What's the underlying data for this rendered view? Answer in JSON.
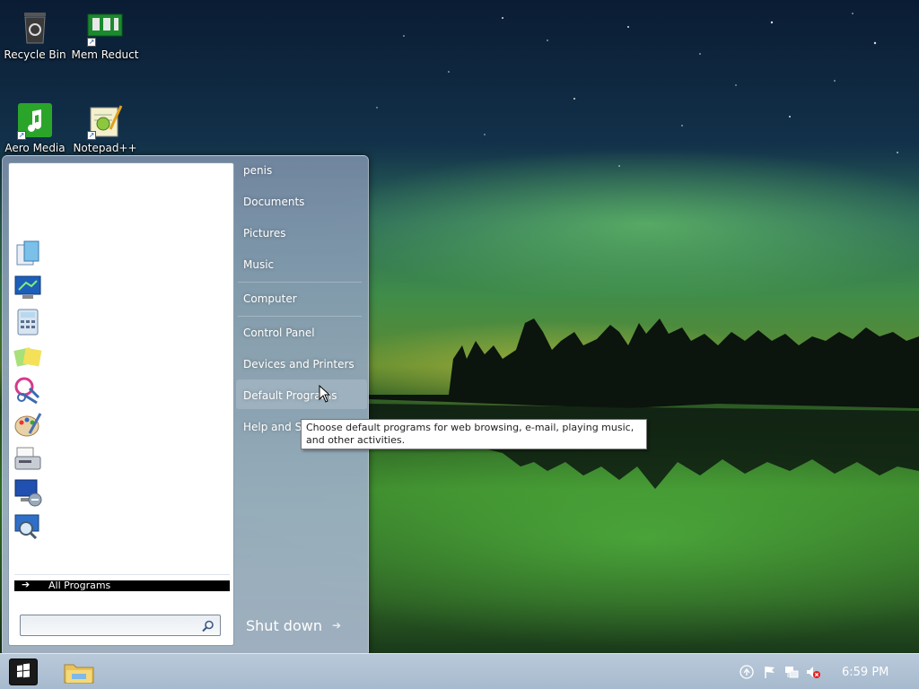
{
  "desktop": {
    "icons": [
      {
        "label": "Recycle Bin",
        "icon": "recycle-bin-icon"
      },
      {
        "label": "Mem Reduct",
        "icon": "memory-icon"
      },
      {
        "label": "Aero Media",
        "icon": "music-note-icon"
      },
      {
        "label": "Notepad++",
        "icon": "notepad-icon"
      }
    ]
  },
  "start_menu": {
    "pinned_programs": [
      {
        "icon": "getting-started-icon"
      },
      {
        "icon": "remote-desktop-icon"
      },
      {
        "icon": "calculator-icon"
      },
      {
        "icon": "sticky-notes-icon"
      },
      {
        "icon": "snipping-tool-icon"
      },
      {
        "icon": "paint-icon"
      },
      {
        "icon": "fax-scan-icon"
      },
      {
        "icon": "remote-connection-icon"
      },
      {
        "icon": "magnifier-icon"
      }
    ],
    "all_programs_label": "All Programs",
    "search_placeholder": "",
    "right_items": [
      {
        "label": "penis"
      },
      {
        "label": "Documents"
      },
      {
        "label": "Pictures"
      },
      {
        "label": "Music"
      },
      {
        "label": "Computer"
      },
      {
        "label": "Control Panel"
      },
      {
        "label": "Devices and Printers"
      },
      {
        "label": "Default Programs"
      },
      {
        "label": "Help and Support"
      }
    ],
    "shutdown_label": "Shut down",
    "tooltip": "Choose default programs for web browsing, e-mail, playing music, and other activities."
  },
  "taskbar": {
    "clock": "6:59 PM",
    "tray_icons": [
      "action-center-up-icon",
      "flag-icon",
      "network-icon",
      "volume-muted-icon"
    ],
    "pinned": [
      "windows-start-icon",
      "file-explorer-icon"
    ]
  },
  "colors": {
    "taskbar": "#b0c2d4",
    "start_menu": "#8fa4bd",
    "tooltip_bg": "#ffffff"
  }
}
